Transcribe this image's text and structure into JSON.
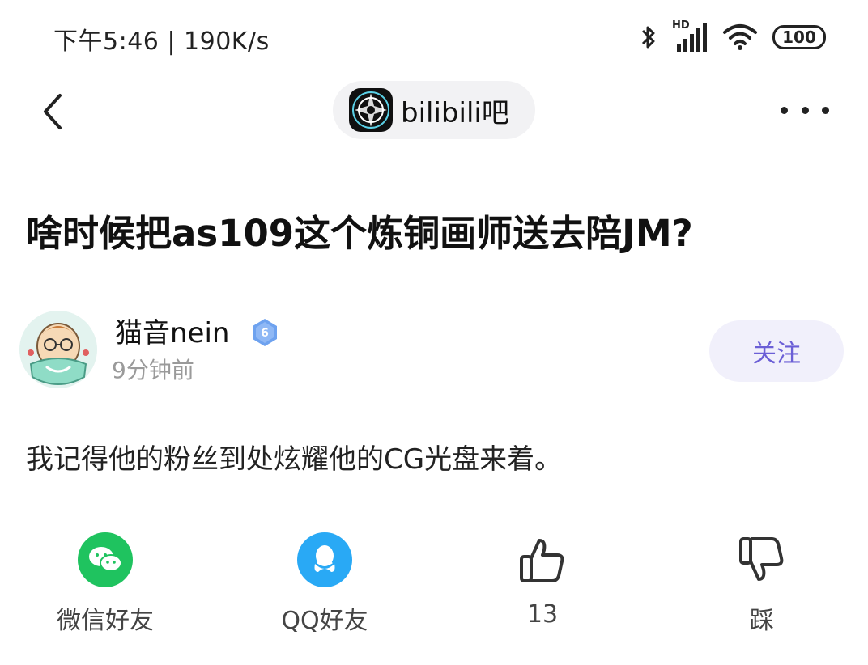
{
  "status_bar": {
    "time": "下午5:46 | 190K/s",
    "network_label": "HD",
    "battery": "100"
  },
  "nav": {
    "forum_name": "bilibili吧"
  },
  "post": {
    "title": "啥时候把as109这个炼铜画师送去陪JM?",
    "body": "我记得他的粉丝到处炫耀他的CG光盘来着。"
  },
  "author": {
    "name": "猫音nein",
    "level": "6",
    "time_ago": "9分钟前",
    "follow_label": "关注"
  },
  "actions": [
    {
      "label": "微信好友",
      "icon": "wechat-icon"
    },
    {
      "label": "QQ好友",
      "icon": "qq-icon"
    },
    {
      "label": "13",
      "icon": "thumbs-up-icon"
    },
    {
      "label": "踩",
      "icon": "thumbs-down-icon"
    }
  ],
  "colors": {
    "follow_accent": "#6b5fd6",
    "wechat_green": "#1fc35f",
    "qq_blue": "#29a9f5",
    "level_badge": "#6ea2ef"
  }
}
